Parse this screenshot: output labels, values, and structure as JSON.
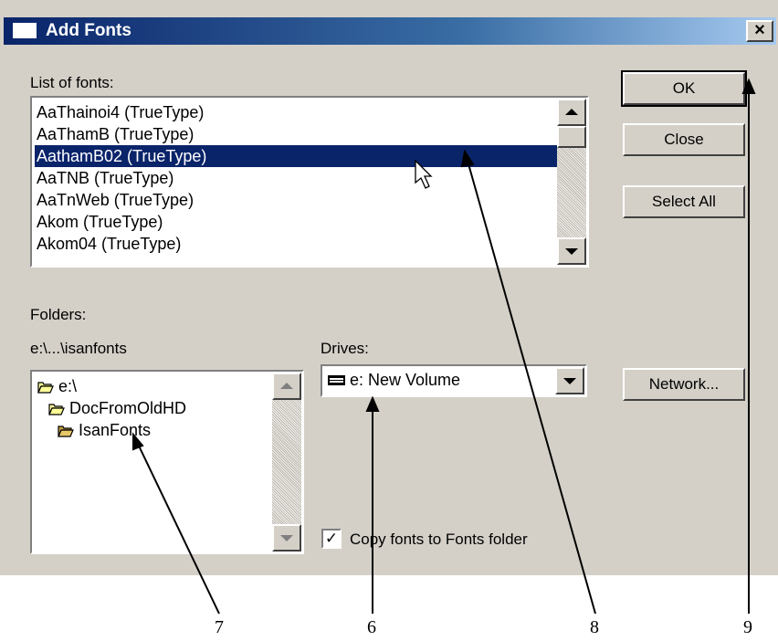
{
  "dialog": {
    "title": "Add Fonts",
    "close_glyph": "×"
  },
  "fonts": {
    "label": "List of fonts:",
    "items": [
      "AaThainoi4 (TrueType)",
      "AaThamB (TrueType)",
      "AathamB02 (TrueType)",
      "AaTNB (TrueType)",
      "AaTnWeb (TrueType)",
      "Akom (TrueType)",
      "Akom04 (TrueType)"
    ],
    "selected": "AathamB02 (TrueType)"
  },
  "buttons": {
    "ok": "OK",
    "close": "Close",
    "select_all": "Select All",
    "network": "Network..."
  },
  "folders": {
    "label": "Folders:",
    "path": "e:\\...\\isanfonts",
    "items": [
      "e:\\",
      "DocFromOldHD",
      "IsanFonts"
    ]
  },
  "drives": {
    "label": "Drives:",
    "value": "e: New Volume"
  },
  "copy_fonts": {
    "label": "Copy fonts to Fonts folder",
    "checked": true,
    "check_glyph": "✓"
  },
  "callouts": [
    "7",
    "6",
    "8",
    "9"
  ],
  "icons": {
    "folder": "folder-open-icon",
    "drive": "drive-icon",
    "cursor": "mouse-pointer-icon"
  },
  "colors": {
    "selection": "#0a246a",
    "title_start": "#0a246a",
    "title_end": "#a6caf0",
    "face": "#d4d0c8"
  }
}
